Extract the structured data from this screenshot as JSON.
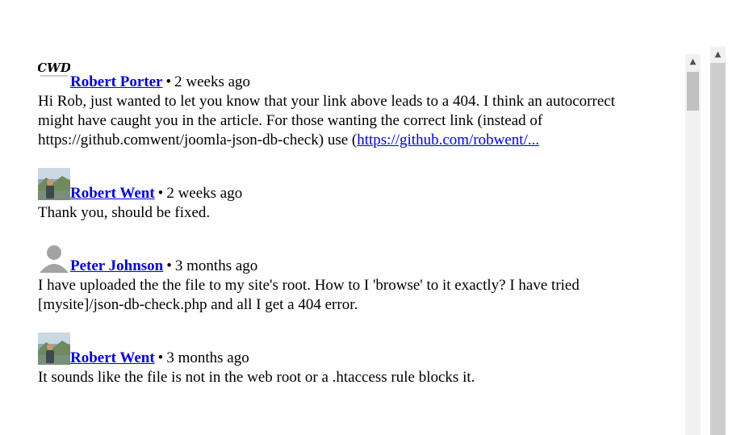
{
  "comments": [
    {
      "author": "Robert Porter",
      "separator": "•",
      "time": "2 weeks ago",
      "avatar": "cwd-logo-avatar",
      "body": "Hi Rob, just wanted to let you know that your link above leads to a 404. I think an autocorrect might have caught you in the article. For those wanting the correct link (instead of https://github.comwent/joomla-json-db-check) use (",
      "link_text": "https://github.com/robwent/...",
      "avatar_text": "CWD"
    },
    {
      "author": "Robert Went",
      "separator": "•",
      "time": "2 weeks ago",
      "avatar": "photo-avatar",
      "body": "Thank you, should be fixed."
    },
    {
      "author": "Peter Johnson",
      "separator": "•",
      "time": "3 months ago",
      "avatar": "default-user-avatar",
      "body": "I have uploaded the the file to my site's root. How to I 'browse' to it exactly? I have tried [mysite]/json-db-check.php and all I get a 404 error."
    },
    {
      "author": "Robert Went",
      "separator": "•",
      "time": "3 months ago",
      "avatar": "photo-avatar",
      "body": "It sounds like the file is not in the web root or a .htaccess rule blocks it."
    }
  ],
  "colors": {
    "link": "#0000ee",
    "scroll_track": "#f1f1f1",
    "scroll_thumb": "#c1c1c1",
    "outer_track": "#cdcdcd"
  },
  "icons": {
    "scroll_up": "▲"
  }
}
